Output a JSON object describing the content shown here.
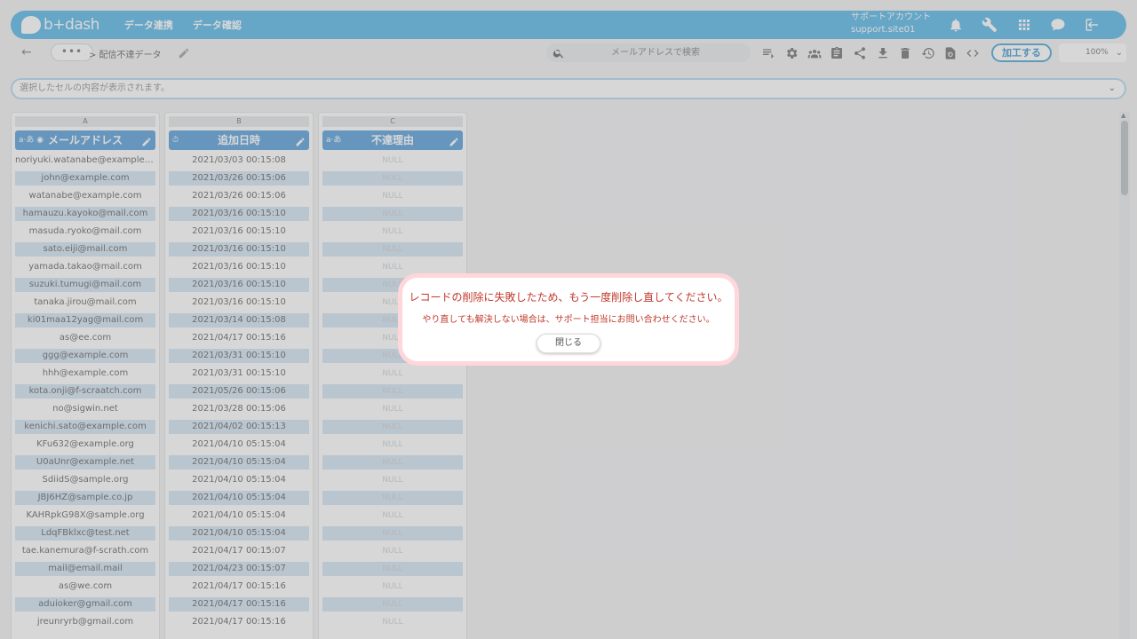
{
  "header": {
    "logo_text": "b+dash",
    "nav": [
      "データ連携",
      "データ確認"
    ],
    "account_name": "サポートアカウント",
    "account_id": "support.site01",
    "icons": [
      "bell-icon",
      "wrench-icon",
      "apps-grid-icon",
      "chat-icon",
      "logout-icon"
    ]
  },
  "toolbar": {
    "more_label": "•••",
    "breadcrumb": "> 配信不達データ",
    "search_placeholder": "メールアドレスで検索",
    "icons": [
      "column-list-icon",
      "settings-gear-icon",
      "group-icon",
      "clipboard-icon",
      "share-icon",
      "download-icon",
      "delete-icon",
      "history-icon",
      "file-sync-icon",
      "code-icon"
    ],
    "process_label": "加工する",
    "zoom": "100%"
  },
  "cellbar": {
    "text": "選択したセルの内容が表示されます。"
  },
  "columns": [
    {
      "letter": "A",
      "title": "メールアドレス",
      "type_label": "a-あ"
    },
    {
      "letter": "B",
      "title": "追加日時",
      "type_label": "clock"
    },
    {
      "letter": "C",
      "title": "不達理由",
      "type_label": "a-あ"
    }
  ],
  "rows": [
    {
      "email": "noriyuki.watanabe@example.c...",
      "date": "2021/03/03 00:15:08",
      "reason": "NULL"
    },
    {
      "email": "john@example.com",
      "date": "2021/03/26 00:15:06",
      "reason": "NULL"
    },
    {
      "email": "watanabe@example.com",
      "date": "2021/03/26 00:15:06",
      "reason": "NULL"
    },
    {
      "email": "hamauzu.kayoko@mail.com",
      "date": "2021/03/16 00:15:10",
      "reason": "NULL"
    },
    {
      "email": "masuda.ryoko@mail.com",
      "date": "2021/03/16 00:15:10",
      "reason": "NULL"
    },
    {
      "email": "sato.eiji@mail.com",
      "date": "2021/03/16 00:15:10",
      "reason": "NULL"
    },
    {
      "email": "yamada.takao@mail.com",
      "date": "2021/03/16 00:15:10",
      "reason": "NULL"
    },
    {
      "email": "suzuki.tumugi@mail.com",
      "date": "2021/03/16 00:15:10",
      "reason": "NULL"
    },
    {
      "email": "tanaka.jirou@mail.com",
      "date": "2021/03/16 00:15:10",
      "reason": "NULL"
    },
    {
      "email": "ki01maa12yag@mail.com",
      "date": "2021/03/14 00:15:08",
      "reason": "NULL"
    },
    {
      "email": "as@ee.com",
      "date": "2021/04/17 00:15:16",
      "reason": "NULL"
    },
    {
      "email": "ggg@example.com",
      "date": "2021/03/31 00:15:10",
      "reason": "NULL"
    },
    {
      "email": "hhh@example.com",
      "date": "2021/03/31 00:15:10",
      "reason": "NULL"
    },
    {
      "email": "kota.onji@f-scraatch.com",
      "date": "2021/05/26 00:15:06",
      "reason": "NULL"
    },
    {
      "email": "no@sigwin.net",
      "date": "2021/03/28 00:15:06",
      "reason": "NULL"
    },
    {
      "email": "kenichi.sato@example.com",
      "date": "2021/04/02 00:15:13",
      "reason": "NULL"
    },
    {
      "email": "KFu632@example.org",
      "date": "2021/04/10 05:15:04",
      "reason": "NULL"
    },
    {
      "email": "U0aUnr@example.net",
      "date": "2021/04/10 05:15:04",
      "reason": "NULL"
    },
    {
      "email": "SdiidS@sample.org",
      "date": "2021/04/10 05:15:04",
      "reason": "NULL"
    },
    {
      "email": "JBJ6HZ@sample.co.jp",
      "date": "2021/04/10 05:15:04",
      "reason": "NULL"
    },
    {
      "email": "KAHRpkG98X@sample.org",
      "date": "2021/04/10 05:15:04",
      "reason": "NULL"
    },
    {
      "email": "LdqFBklxc@test.net",
      "date": "2021/04/10 05:15:04",
      "reason": "NULL"
    },
    {
      "email": "tae.kanemura@f-scrath.com",
      "date": "2021/04/17 00:15:07",
      "reason": "NULL"
    },
    {
      "email": "mail@email.mail",
      "date": "2021/04/23 00:15:07",
      "reason": "NULL"
    },
    {
      "email": "as@we.com",
      "date": "2021/04/17 00:15:16",
      "reason": "NULL"
    },
    {
      "email": "aduioker@gmail.com",
      "date": "2021/04/17 00:15:16",
      "reason": "NULL"
    },
    {
      "email": "jreunryrb@gmail.com",
      "date": "2021/04/17 00:15:16",
      "reason": "NULL"
    }
  ],
  "modal": {
    "message": "レコードの削除に失敗したため、もう一度削除し直してください。",
    "sub_message": "やり直しても解決しない場合は、サポート担当にお問い合わせください。",
    "close_label": "閉じる"
  },
  "colors": {
    "header_bg": "#4ab0e6",
    "column_header_bg": "#4a97d6",
    "alt_row_bg": "#cfe3f3",
    "error_text": "#c0392b",
    "modal_border": "#ffd6da"
  }
}
